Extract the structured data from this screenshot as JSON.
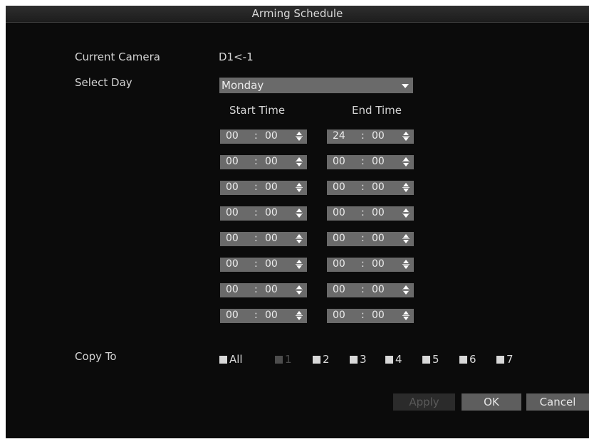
{
  "dialog": {
    "title": "Arming Schedule"
  },
  "current_camera": {
    "label": "Current Camera",
    "value": "D1<-1"
  },
  "select_day": {
    "label": "Select Day",
    "value": "Monday"
  },
  "columns": {
    "start": "Start Time",
    "end": "End Time"
  },
  "rows": [
    {
      "start_h": "00",
      "start_m": "00",
      "end_h": "24",
      "end_m": "00"
    },
    {
      "start_h": "00",
      "start_m": "00",
      "end_h": "00",
      "end_m": "00"
    },
    {
      "start_h": "00",
      "start_m": "00",
      "end_h": "00",
      "end_m": "00"
    },
    {
      "start_h": "00",
      "start_m": "00",
      "end_h": "00",
      "end_m": "00"
    },
    {
      "start_h": "00",
      "start_m": "00",
      "end_h": "00",
      "end_m": "00"
    },
    {
      "start_h": "00",
      "start_m": "00",
      "end_h": "00",
      "end_m": "00"
    },
    {
      "start_h": "00",
      "start_m": "00",
      "end_h": "00",
      "end_m": "00"
    },
    {
      "start_h": "00",
      "start_m": "00",
      "end_h": "00",
      "end_m": "00"
    }
  ],
  "time_separator": ":",
  "copy_to": {
    "label": "Copy To",
    "options": [
      {
        "label": "All",
        "enabled": true
      },
      {
        "label": "1",
        "enabled": false
      },
      {
        "label": "2",
        "enabled": true
      },
      {
        "label": "3",
        "enabled": true
      },
      {
        "label": "4",
        "enabled": true
      },
      {
        "label": "5",
        "enabled": true
      },
      {
        "label": "6",
        "enabled": true
      },
      {
        "label": "7",
        "enabled": true
      }
    ]
  },
  "buttons": {
    "apply": "Apply",
    "ok": "OK",
    "cancel": "Cancel"
  },
  "colors": {
    "background": "#0b0b0b",
    "field": "#6a6a6a",
    "text": "#d4d4d4",
    "disabled": "#4d4d4d"
  }
}
